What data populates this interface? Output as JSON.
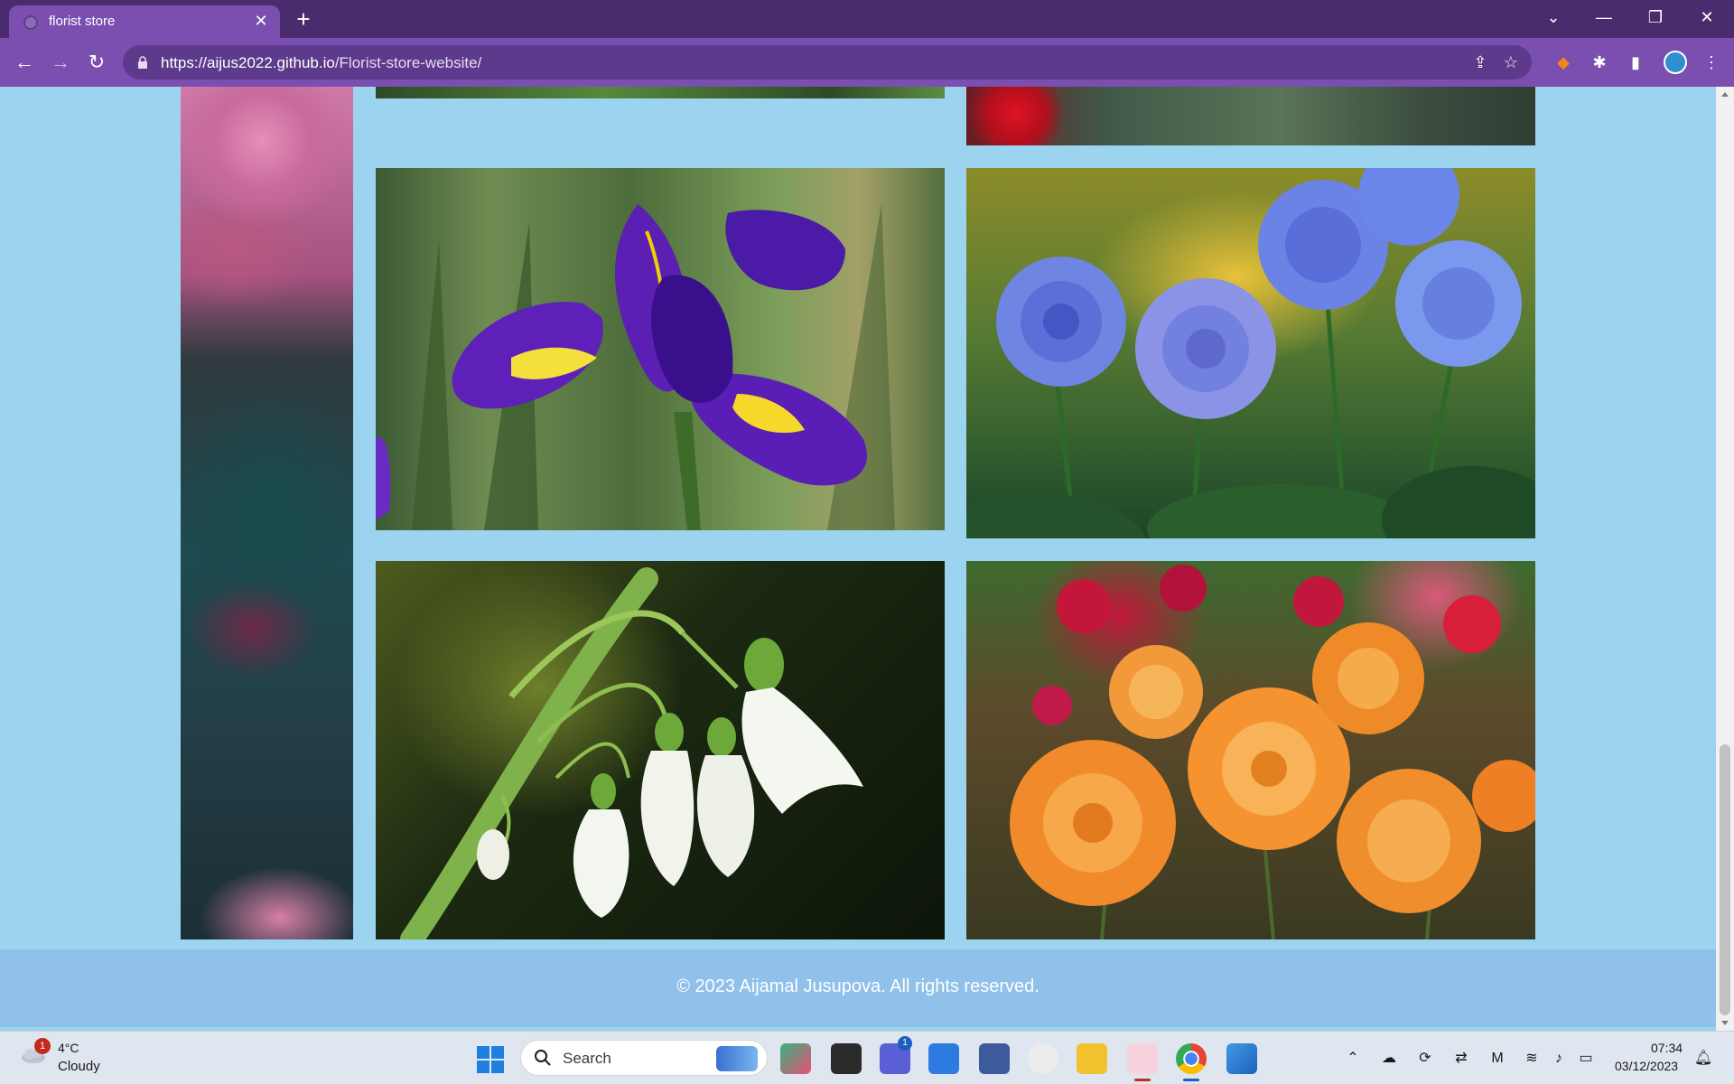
{
  "browser": {
    "tab_title": "florist store",
    "url_host": "https://aijus2022.github.io",
    "url_path": "/Florist-store-website/",
    "accent": "#7a4fb0"
  },
  "page": {
    "background": "#9cd3ee",
    "footer_text": "© 2023 Aijamal Jusupova. All rights reserved.",
    "gallery": [
      {
        "name": "iris",
        "description": "purple iris flower"
      },
      {
        "name": "blue-roses",
        "description": "blue roses"
      },
      {
        "name": "snowdrops",
        "description": "white snowdrop flowers"
      },
      {
        "name": "dahlias",
        "description": "orange dahlias"
      }
    ]
  },
  "taskbar": {
    "weather_temp": "4°C",
    "weather_condition": "Cloudy",
    "weather_badge": "1",
    "search_label": "Search",
    "teams_badge": "1",
    "clock_time": "07:34",
    "clock_date": "03/12/2023"
  }
}
